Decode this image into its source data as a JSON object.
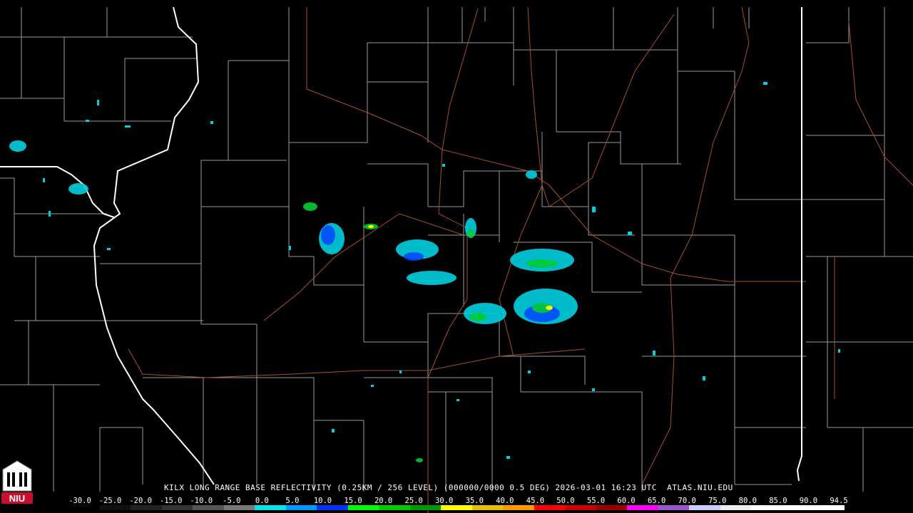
{
  "caption": "KILX LONG RANGE BASE REFLECTIVITY (0.25KM / 256 LEVEL) (000000/0000 0.5 DEG) 2026-03-01 16:23 UTC  ATLAS.NIU.EDU",
  "logo": {
    "text": "NIU",
    "icon": "niu-castle-icon",
    "color": "#c8102e"
  },
  "colorbar": {
    "ticks": [
      "-30.0",
      "-25.0",
      "-20.0",
      "-15.0",
      "-10.0",
      "-5.0",
      "0.0",
      "5.0",
      "10.0",
      "15.0",
      "20.0",
      "25.0",
      "30.0",
      "35.0",
      "40.0",
      "45.0",
      "50.0",
      "55.0",
      "60.0",
      "65.0",
      "70.0",
      "75.0",
      "80.0",
      "85.0",
      "90.0",
      "94.5"
    ],
    "colors": [
      "#000000",
      "#111111",
      "#222222",
      "#333333",
      "#555555",
      "#777777",
      "#00e6e6",
      "#0099ff",
      "#0033ff",
      "#00ff00",
      "#00cc00",
      "#009900",
      "#ffff00",
      "#e6c000",
      "#ff9900",
      "#ff0000",
      "#cc0000",
      "#990000",
      "#ff00ff",
      "#9955cc",
      "#ccccff",
      "#eeeeee",
      "#ffffff",
      "#ffffff",
      "#ffffff"
    ]
  },
  "map": {
    "radar_site": "KILX",
    "colors": {
      "county_lines": "#9a9a9a",
      "state_lines": "#ffffff",
      "highways": "#a0522d",
      "background": "#000000"
    }
  }
}
